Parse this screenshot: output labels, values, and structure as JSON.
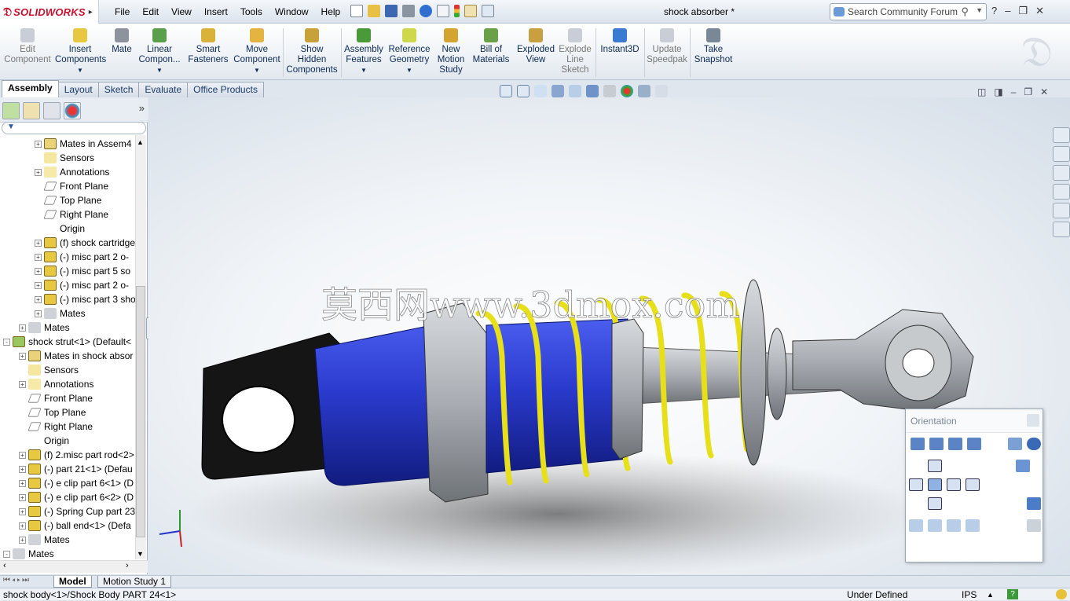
{
  "app": {
    "name": "SOLIDWORKS",
    "document_title": "shock absorber *"
  },
  "menu": [
    "File",
    "Edit",
    "View",
    "Insert",
    "Tools",
    "Window",
    "Help"
  ],
  "search": {
    "placeholder": "Search Community Forum"
  },
  "ribbon": [
    {
      "label": "Edit Component",
      "enabled": false
    },
    {
      "label": "Insert Components",
      "enabled": true
    },
    {
      "label": "Mate",
      "enabled": true
    },
    {
      "label": "Linear Compon...",
      "enabled": true
    },
    {
      "label": "Smart Fasteners",
      "enabled": true
    },
    {
      "label": "Move Component",
      "enabled": true
    },
    {
      "label": "Show Hidden Components",
      "enabled": true
    },
    {
      "label": "Assembly Features",
      "enabled": true
    },
    {
      "label": "Reference Geometry",
      "enabled": true
    },
    {
      "label": "New Motion Study",
      "enabled": true
    },
    {
      "label": "Bill of Materials",
      "enabled": true
    },
    {
      "label": "Exploded View",
      "enabled": true
    },
    {
      "label": "Explode Line Sketch",
      "enabled": false
    },
    {
      "label": "Instant3D",
      "enabled": true
    },
    {
      "label": "Update Speedpak",
      "enabled": false
    },
    {
      "label": "Take Snapshot",
      "enabled": true
    }
  ],
  "command_tabs": [
    "Assembly",
    "Layout",
    "Sketch",
    "Evaluate",
    "Office Products"
  ],
  "active_command_tab": "Assembly",
  "tree": [
    {
      "label": "Mates in Assem4",
      "icon": "mates-folder-icon",
      "expander": "+"
    },
    {
      "label": "Sensors",
      "icon": "sensor-icon",
      "expander": ""
    },
    {
      "label": "Annotations",
      "icon": "annotations-icon",
      "expander": "+"
    },
    {
      "label": "Front Plane",
      "icon": "plane-icon",
      "expander": ""
    },
    {
      "label": "Top Plane",
      "icon": "plane-icon",
      "expander": ""
    },
    {
      "label": "Right Plane",
      "icon": "plane-icon",
      "expander": ""
    },
    {
      "label": "Origin",
      "icon": "origin-icon",
      "expander": ""
    },
    {
      "label": "(f) shock cartridge",
      "icon": "part-icon",
      "expander": "+"
    },
    {
      "label": "(-) misc part 2 o-",
      "icon": "part-icon",
      "expander": "+"
    },
    {
      "label": "(-) misc part 5  so",
      "icon": "part-icon",
      "expander": "+"
    },
    {
      "label": "(-) misc part 2 o-",
      "icon": "part-icon",
      "expander": "+"
    },
    {
      "label": "(-) misc part 3 sho",
      "icon": "part-icon",
      "expander": "+"
    },
    {
      "label": "Mates",
      "icon": "mates-icon",
      "expander": "+"
    },
    {
      "label": "Mates",
      "icon": "mates-icon",
      "expander": "+"
    },
    {
      "label": "shock strut<1> (Default<",
      "icon": "subassembly-icon",
      "expander": "-"
    },
    {
      "label": "Mates in shock absor",
      "icon": "mates-folder-icon",
      "expander": "+"
    },
    {
      "label": "Sensors",
      "icon": "sensor-icon",
      "expander": ""
    },
    {
      "label": "Annotations",
      "icon": "annotations-icon",
      "expander": "+"
    },
    {
      "label": "Front Plane",
      "icon": "plane-icon",
      "expander": ""
    },
    {
      "label": "Top Plane",
      "icon": "plane-icon",
      "expander": ""
    },
    {
      "label": "Right Plane",
      "icon": "plane-icon",
      "expander": ""
    },
    {
      "label": "Origin",
      "icon": "origin-icon",
      "expander": ""
    },
    {
      "label": "(f) 2.misc part rod<2>",
      "icon": "part-icon",
      "expander": "+"
    },
    {
      "label": "(-) part 21<1> (Defau",
      "icon": "part-icon",
      "expander": "+"
    },
    {
      "label": "(-) e clip part 6<1> (D",
      "icon": "part-icon",
      "expander": "+"
    },
    {
      "label": "(-) e clip part 6<2> (D",
      "icon": "part-icon",
      "expander": "+"
    },
    {
      "label": "(-) Spring Cup part 23",
      "icon": "part-icon",
      "expander": "+"
    },
    {
      "label": "(-) ball end<1> (Defa",
      "icon": "part-icon",
      "expander": "+"
    },
    {
      "label": "Mates",
      "icon": "mates-icon",
      "expander": "+"
    },
    {
      "label": "Mates",
      "icon": "mates-icon",
      "expander": "-"
    }
  ],
  "watermark": "莫西网www.3dmox.com",
  "orientation": {
    "title": "Orientation"
  },
  "bottom_tabs": [
    "Model",
    "Motion Study 1"
  ],
  "status": {
    "path": "shock body<1>/Shock Body PART 24<1>",
    "state": "Under Defined",
    "units": "IPS"
  },
  "colors": {
    "body": "#2233c8",
    "spring": "#e6df1a",
    "steel": "#a9adb3",
    "cap": "#111111",
    "brand": "#c8102e"
  }
}
